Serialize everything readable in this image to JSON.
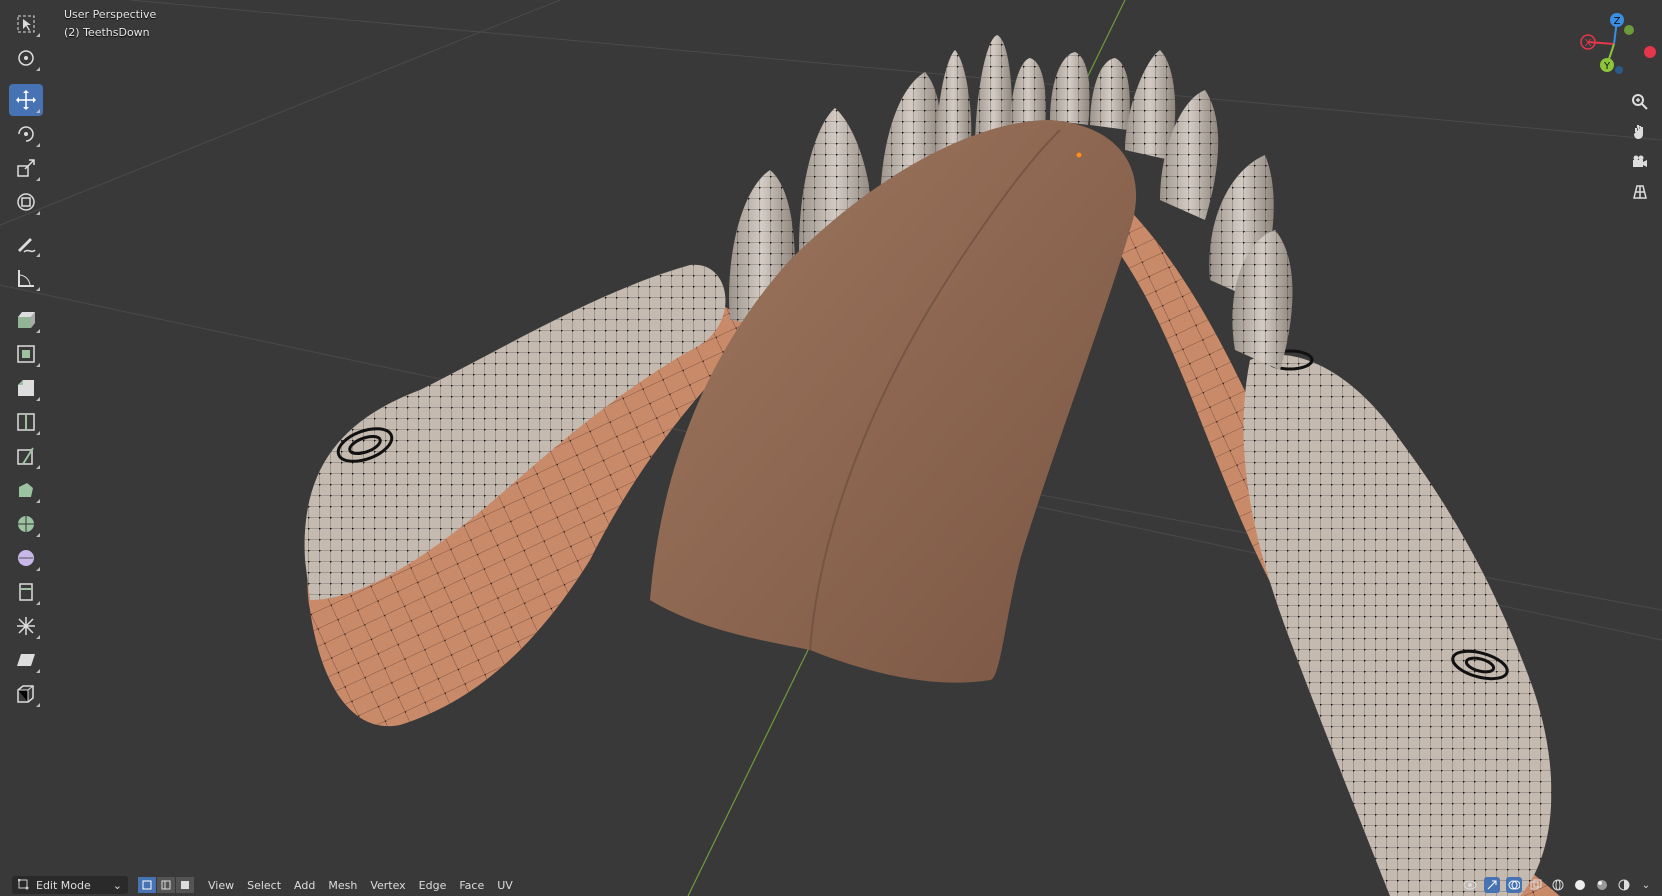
{
  "viewport": {
    "view_name": "User Perspective",
    "object_label": "(2) TeethsDown"
  },
  "toolbar": {
    "tools": [
      {
        "icon": "select-box-icon",
        "active": false
      },
      {
        "icon": "cursor-icon",
        "active": false
      },
      {
        "icon": "move-icon",
        "active": true
      },
      {
        "icon": "rotate-icon",
        "active": false
      },
      {
        "icon": "scale-icon",
        "active": false
      },
      {
        "icon": "transform-icon",
        "active": false
      },
      {
        "icon": "annotate-icon",
        "active": false
      },
      {
        "icon": "measure-icon",
        "active": false
      },
      {
        "icon": "extrude-region-icon",
        "active": false
      },
      {
        "icon": "inset-faces-icon",
        "active": false
      },
      {
        "icon": "bevel-icon",
        "active": false
      },
      {
        "icon": "loop-cut-icon",
        "active": false
      },
      {
        "icon": "knife-icon",
        "active": false
      },
      {
        "icon": "poly-build-icon",
        "active": false
      },
      {
        "icon": "spin-icon",
        "active": false
      },
      {
        "icon": "smooth-icon",
        "active": false
      },
      {
        "icon": "edge-slide-icon",
        "active": false
      },
      {
        "icon": "shrink-fatten-icon",
        "active": false
      },
      {
        "icon": "shear-icon",
        "active": false
      },
      {
        "icon": "rip-region-icon",
        "active": false
      }
    ]
  },
  "gizmo": {
    "axis_x": "X",
    "axis_y": "Y",
    "axis_z": "Z",
    "colors": {
      "x": "#e5364b",
      "y": "#8cc43a",
      "z": "#3a8fe5"
    }
  },
  "header": {
    "mode": "Edit Mode",
    "menus": [
      "View",
      "Select",
      "Add",
      "Mesh",
      "Vertex",
      "Edge",
      "Face",
      "UV"
    ]
  },
  "colors": {
    "background": "#393939",
    "active_tool": "#4772b3",
    "mesh_skin": "#c88a6c",
    "mesh_teeth": "#c4bab0",
    "tongue": "#8f6a55"
  }
}
